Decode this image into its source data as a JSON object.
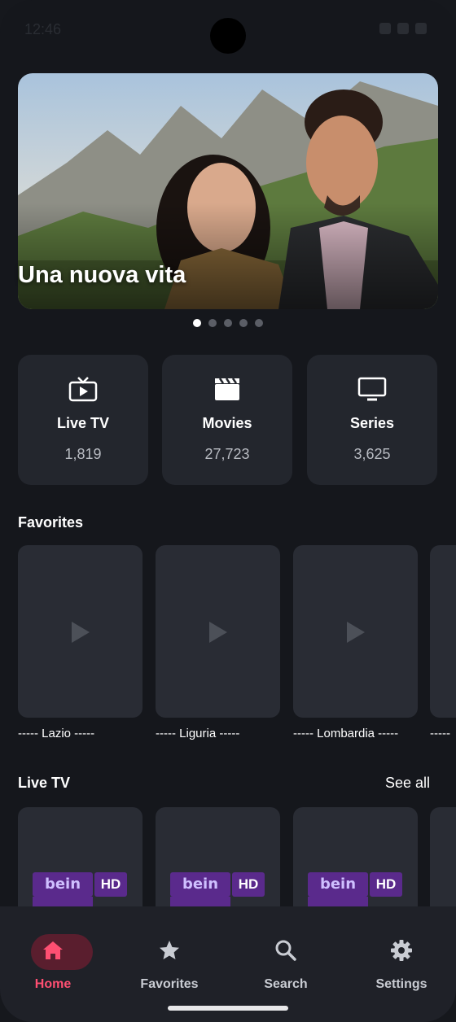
{
  "status": {
    "time": "12:46"
  },
  "hero": {
    "title": "Una nuova vita",
    "slides": 5,
    "active_slide": 1
  },
  "categories": [
    {
      "label": "Live TV",
      "count": "1,819",
      "icon": "tv-icon"
    },
    {
      "label": "Movies",
      "count": "27,723",
      "icon": "clapperboard-icon"
    },
    {
      "label": "Series",
      "count": "3,625",
      "icon": "monitor-icon"
    }
  ],
  "favorites": {
    "title": "Favorites",
    "items": [
      {
        "label": "----- Lazio -----"
      },
      {
        "label": "----- Liguria -----"
      },
      {
        "label": "----- Lombardia -----"
      },
      {
        "label": "-----"
      }
    ]
  },
  "live_tv": {
    "title": "Live TV",
    "see_all": "See all",
    "channels": [
      {
        "logo": "bein",
        "badge": "HD"
      },
      {
        "logo": "bein",
        "badge": "HD"
      },
      {
        "logo": "bein",
        "badge": "HD"
      }
    ]
  },
  "nav": {
    "items": [
      {
        "label": "Home",
        "icon": "home-icon",
        "active": true
      },
      {
        "label": "Favorites",
        "icon": "star-icon",
        "active": false
      },
      {
        "label": "Search",
        "icon": "search-icon",
        "active": false
      },
      {
        "label": "Settings",
        "icon": "gear-icon",
        "active": false
      }
    ]
  },
  "colors": {
    "background": "#15171c",
    "card": "#23262d",
    "accent": "#ff4f72",
    "accent_pill": "#5a1e2e"
  }
}
